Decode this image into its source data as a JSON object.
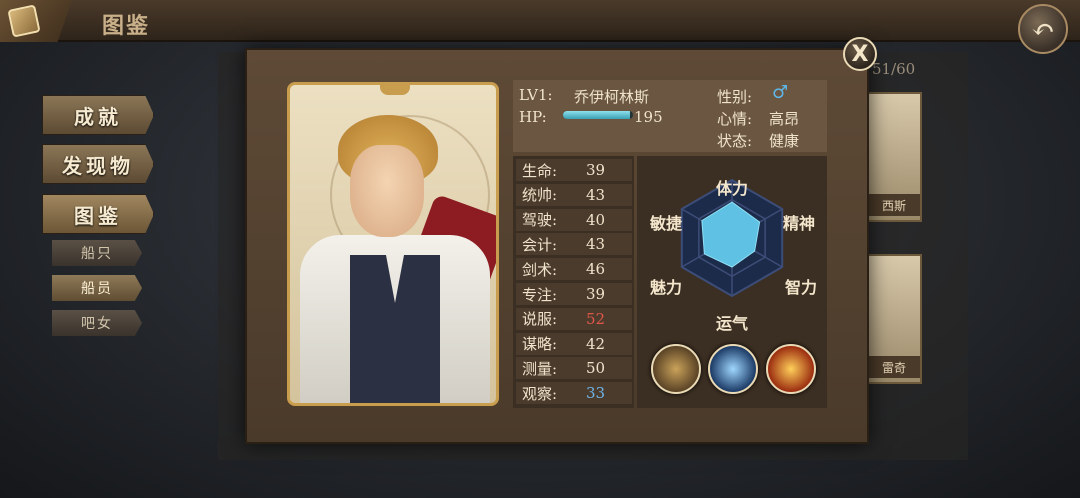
{
  "header": {
    "title": "图鉴",
    "book_icon": "book-icon",
    "back_icon": "back-arrow-icon"
  },
  "menu": {
    "items": [
      {
        "label": "成就"
      },
      {
        "label": "发现物"
      },
      {
        "label": "图鉴"
      }
    ],
    "subitems": [
      {
        "label": "船只"
      },
      {
        "label": "船员"
      },
      {
        "label": "吧女"
      }
    ]
  },
  "collection": {
    "counter": "51/60",
    "cards": [
      {
        "name": "西斯"
      },
      {
        "name": "雷奇"
      }
    ]
  },
  "modal": {
    "close_label": "X",
    "level": "LV1:",
    "name": "乔伊柯林斯",
    "hp_label": "HP:",
    "hp_value": "195",
    "hp_fill": 0.95,
    "gender_label": "性别:",
    "gender_symbol": "♂",
    "mood_label": "心情:",
    "mood_value": "高昂",
    "status_label": "状态:",
    "status_value": "健康",
    "stats": [
      {
        "label": "生命:",
        "value": "39",
        "color": "#efe3cb"
      },
      {
        "label": "统帅:",
        "value": "43",
        "color": "#efe3cb"
      },
      {
        "label": "驾驶:",
        "value": "40",
        "color": "#efe3cb"
      },
      {
        "label": "会计:",
        "value": "43",
        "color": "#efe3cb"
      },
      {
        "label": "剑术:",
        "value": "46",
        "color": "#efe3cb"
      },
      {
        "label": "专注:",
        "value": "39",
        "color": "#efe3cb"
      },
      {
        "label": "说服:",
        "value": "52",
        "color": "#e0574a"
      },
      {
        "label": "谋略:",
        "value": "42",
        "color": "#efe3cb"
      },
      {
        "label": "测量:",
        "value": "50",
        "color": "#efe3cb"
      },
      {
        "label": "观察:",
        "value": "33",
        "color": "#6fb4e8"
      }
    ],
    "radar": {
      "axes": [
        "体力",
        "精神",
        "智力",
        "运气",
        "魅力",
        "敏捷"
      ],
      "values": [
        0.62,
        0.55,
        0.45,
        0.5,
        0.55,
        0.6
      ],
      "fill_color": "#5fc1e4",
      "grid_color": "#3c4d78"
    },
    "skills": [
      {
        "icon": "crate-skill-icon"
      },
      {
        "icon": "lightning-skill-icon"
      },
      {
        "icon": "fire-skill-icon"
      }
    ]
  }
}
